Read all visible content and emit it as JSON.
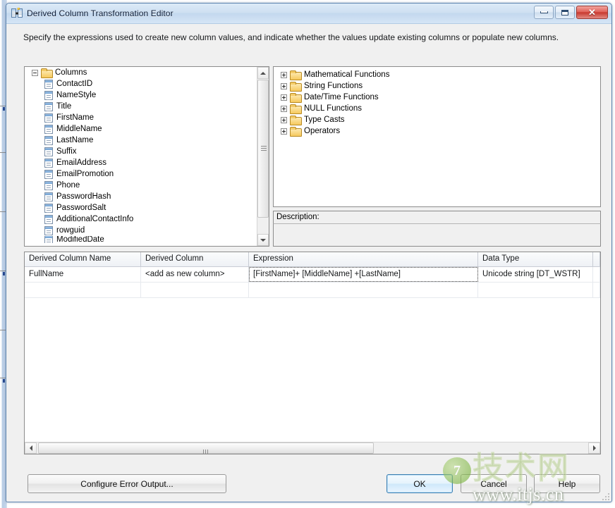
{
  "window": {
    "title": "Derived Column Transformation Editor",
    "icon": "derived-column-icon",
    "minimize_label": "Minimize",
    "maximize_label": "Maximize",
    "close_label": "Close"
  },
  "instruction": "Specify the expressions used to create new column values, and indicate whether the values update existing columns or populate new columns.",
  "columns_tree": {
    "root": "Columns",
    "items": [
      "ContactID",
      "NameStyle",
      "Title",
      "FirstName",
      "MiddleName",
      "LastName",
      "Suffix",
      "EmailAddress",
      "EmailPromotion",
      "Phone",
      "PasswordHash",
      "PasswordSalt",
      "AdditionalContactInfo",
      "rowguid",
      "ModifiedDate"
    ]
  },
  "functions_tree": {
    "items": [
      "Mathematical Functions",
      "String Functions",
      "Date/Time Functions",
      "NULL Functions",
      "Type Casts",
      "Operators"
    ]
  },
  "description": {
    "label": "Description:",
    "text": ""
  },
  "grid": {
    "headers": [
      "Derived Column Name",
      "Derived Column",
      "Expression",
      "Data Type",
      ""
    ],
    "rows": [
      {
        "derived_column_name": "FullName",
        "derived_column": "<add as new column>",
        "expression": "[FirstName]+ [MiddleName] +[LastName]",
        "data_type": "Unicode string [DT_WSTR]",
        "extra": ""
      },
      {
        "derived_column_name": "",
        "derived_column": "",
        "expression": "",
        "data_type": "",
        "extra": ""
      }
    ]
  },
  "buttons": {
    "configure": "Configure Error Output...",
    "ok": "OK",
    "cancel": "Cancel",
    "help": "Help"
  },
  "watermark": {
    "logo_char": "7",
    "brand": "技术网",
    "url": "www.itjs.cn"
  },
  "colors": {
    "accent": "#3c7fb1",
    "titlebar": "#cfe0f2",
    "close_button": "#c83a30",
    "folder": "#f6c95e"
  }
}
